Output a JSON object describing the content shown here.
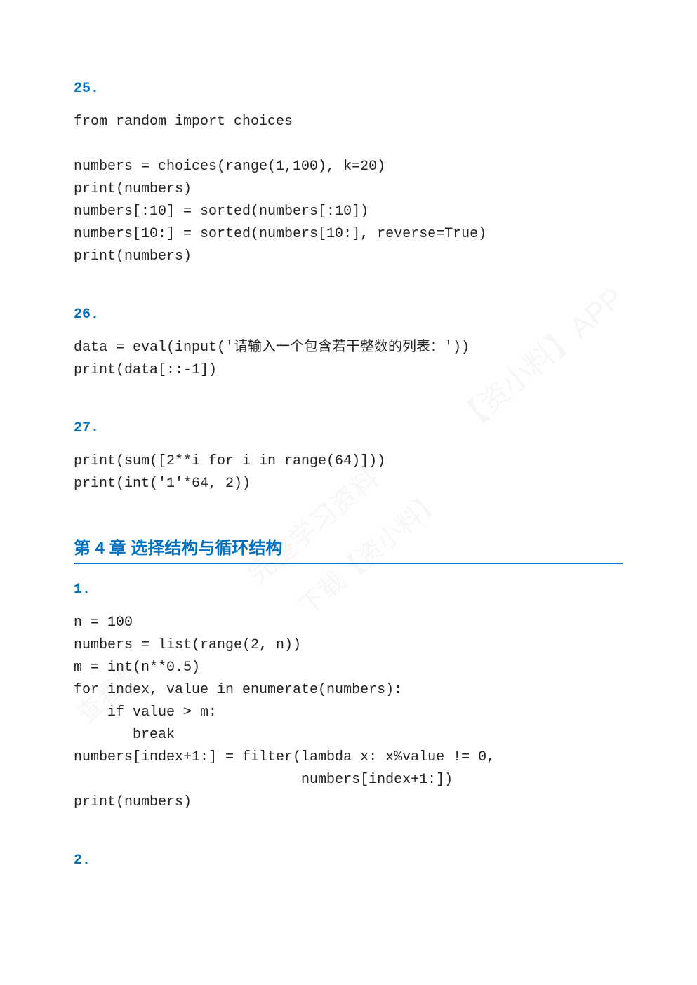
{
  "sections": {
    "s25": {
      "num": "25.",
      "code": "from random import choices\n\nnumbers = choices(range(1,100), k=20)\nprint(numbers)\nnumbers[:10] = sorted(numbers[:10])\nnumbers[10:] = sorted(numbers[10:], reverse=True)\nprint(numbers)"
    },
    "s26": {
      "num": "26.",
      "code": "data = eval(input('请输入一个包含若干整数的列表：'))\nprint(data[::-1])"
    },
    "s27": {
      "num": "27.",
      "code": "print(sum([2**i for i in range(64)]))\nprint(int('1'*64, 2))"
    },
    "chapter": {
      "title": "第 4 章   选择结构与循环结构"
    },
    "s1": {
      "num": "1.",
      "code": "n = 100\nnumbers = list(range(2, n))\nm = int(n**0.5)\nfor index, value in enumerate(numbers):\n    if value > m:\n       break\nnumbers[index+1:] = filter(lambda x: x%value != 0,\n                           numbers[index+1:])\nprint(numbers)"
    },
    "s2": {
      "num": "2."
    }
  },
  "watermark": {
    "w1": "【资小料】APP",
    "w2": "完整学习资料",
    "w3": "下载【资小料】",
    "w4": "查看整"
  }
}
